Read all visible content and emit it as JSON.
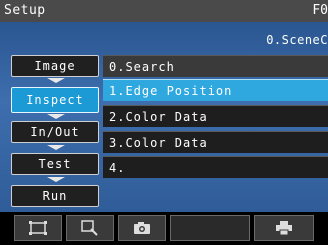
{
  "titlebar": {
    "title": "Setup",
    "right_text": "F0"
  },
  "scene_label": "0.SceneC",
  "nav": {
    "items": [
      {
        "label": "Image"
      },
      {
        "label": "Inspect"
      },
      {
        "label": "In/Out"
      },
      {
        "label": "Test"
      },
      {
        "label": "Run"
      }
    ],
    "active_index": 1
  },
  "menu": {
    "items": [
      {
        "label": "0.Search"
      },
      {
        "label": "1.Edge Position"
      },
      {
        "label": "2.Color Data"
      },
      {
        "label": "3.Color Data"
      },
      {
        "label": "4."
      }
    ],
    "selected_index": 1
  },
  "toolbar": {
    "icons": [
      "fit-screen-icon",
      "zoom-icon",
      "camera-icon",
      "print-icon"
    ]
  },
  "colors": {
    "accent": "#2fa8e0",
    "active_nav": "#1b9ad6",
    "viewer_blue": "#3e6eae"
  }
}
